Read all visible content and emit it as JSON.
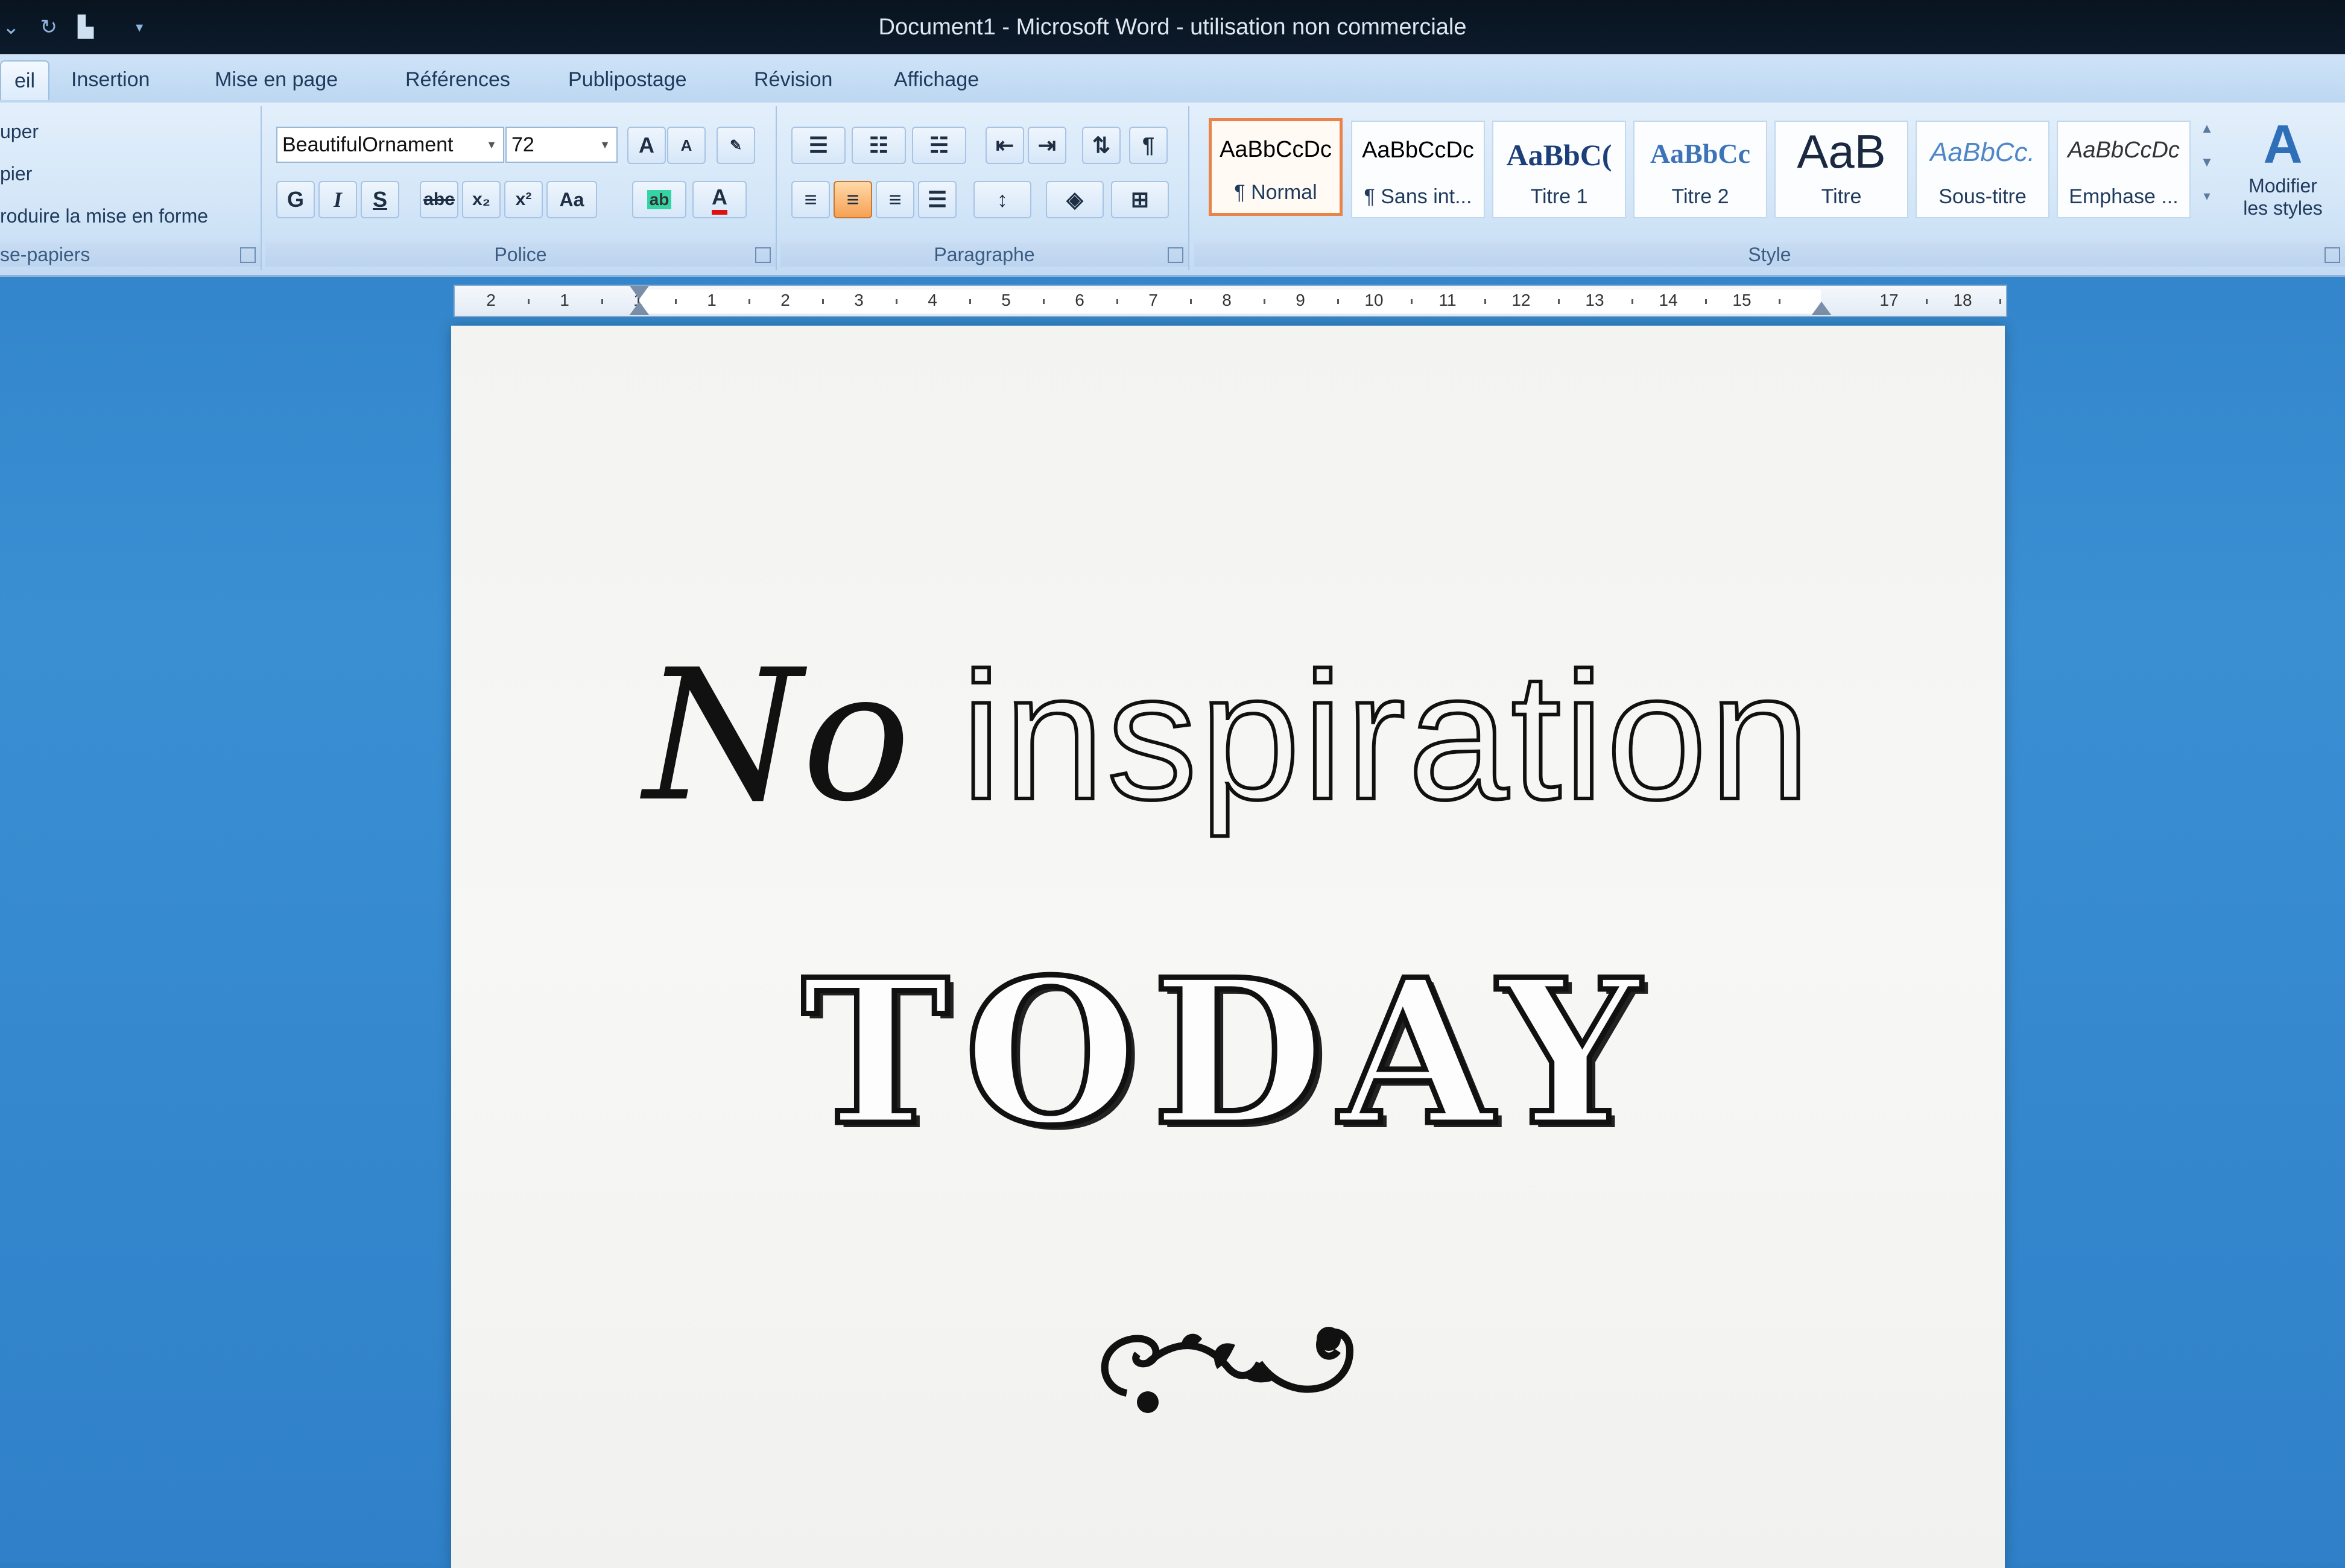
{
  "window": {
    "title": "Document1 - Microsoft Word - utilisation non commerciale"
  },
  "tabs": [
    {
      "label": "eil",
      "active": true
    },
    {
      "label": "Insertion"
    },
    {
      "label": "Mise en page"
    },
    {
      "label": "Références"
    },
    {
      "label": "Publipostage"
    },
    {
      "label": "Révision"
    },
    {
      "label": "Affichage"
    }
  ],
  "clipboard": {
    "items": [
      "uper",
      "pier",
      "roduire la mise en forme"
    ],
    "group_label": "se-papiers"
  },
  "font": {
    "name": "BeautifulOrnament",
    "size": "72",
    "group_label": "Police",
    "bold_label": "G",
    "italic_label": "I",
    "underline_label": "S",
    "strike_label": "abc",
    "subscript_label": "x₂",
    "superscript_label": "x²",
    "case_label": "Aa",
    "grow_label": "A",
    "shrink_label": "A",
    "color_label": "A"
  },
  "paragraph": {
    "group_label": "Paragraphe",
    "pilcrow": "¶"
  },
  "styles": {
    "group_label": "Style",
    "items": [
      {
        "sample": "AaBbCcDc",
        "name": "¶ Normal",
        "selected": true
      },
      {
        "sample": "AaBbCcDc",
        "name": "¶ Sans int..."
      },
      {
        "sample": "AaBbC(",
        "name": "Titre 1"
      },
      {
        "sample": "AaBbCc",
        "name": "Titre 2"
      },
      {
        "sample": "AaB",
        "name": "Titre"
      },
      {
        "sample": "AaBbCc.",
        "name": "Sous-titre"
      },
      {
        "sample": "AaBbCcDc",
        "name": "Emphase ..."
      }
    ],
    "modify_label_1": "Modifier",
    "modify_label_2": "les styles"
  },
  "ruler": {
    "labels": [
      "2",
      "1",
      "1",
      "1",
      "2",
      "3",
      "4",
      "5",
      "6",
      "7",
      "8",
      "9",
      "10",
      "11",
      "12",
      "13",
      "14",
      "15",
      "17",
      "18"
    ]
  },
  "document": {
    "line1_script": "No",
    "line1_outline": "inspiration",
    "line2": "TODAY"
  },
  "colors": {
    "accent_selected": "#e8834a",
    "ribbon": "#d3e6f8",
    "desktop": "#2f80c8"
  }
}
